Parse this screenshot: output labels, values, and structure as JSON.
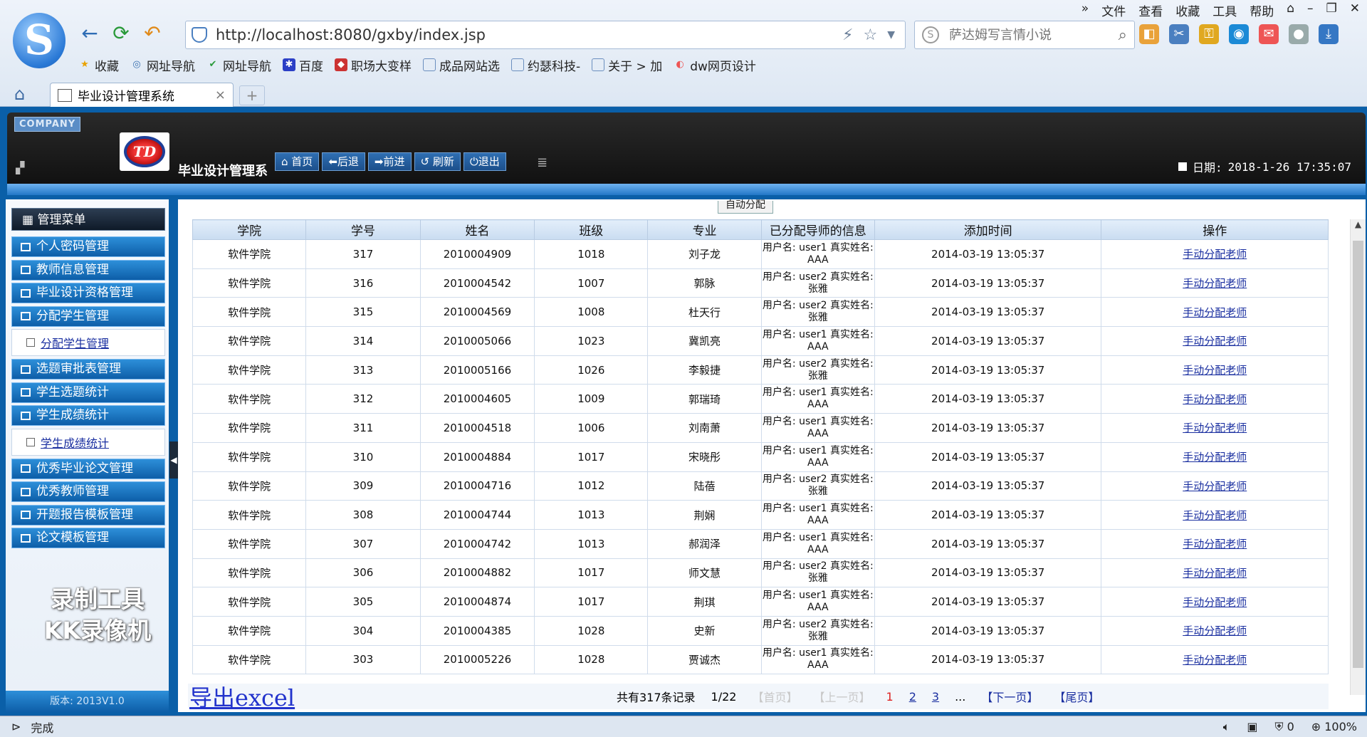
{
  "browser": {
    "menu": [
      "文件",
      "查看",
      "收藏",
      "工具",
      "帮助"
    ],
    "address": "http://localhost:8080/gxby/index.jsp",
    "search_placeholder": "萨达姆写言情小说",
    "favorites": [
      "收藏",
      "网址导航",
      "网址导航",
      "百度",
      "职场大变样",
      "成品网站选",
      "约瑟科技-",
      "关于 > 加",
      "dw网页设计"
    ],
    "tab_title": "毕业设计管理系统",
    "status_text": "完成",
    "status_counter": "0",
    "zoom": "100%"
  },
  "header": {
    "company": "COMPANY",
    "logo_text": "TD",
    "title": "毕业设计管理系",
    "buttons": [
      "首页",
      "后退",
      "前进",
      "刷新",
      "退出"
    ],
    "date_label": "日期:",
    "date_value": "2018-1-26 17:35:07"
  },
  "sidebar": {
    "menu_title": "管理菜单",
    "items": [
      {
        "label": "个人密码管理"
      },
      {
        "label": "教师信息管理"
      },
      {
        "label": "毕业设计资格管理"
      },
      {
        "label": "分配学生管理",
        "sub": "分配学生管理"
      },
      {
        "label": "选题审批表管理"
      },
      {
        "label": "学生选题统计"
      },
      {
        "label": "学生成绩统计",
        "sub": "学生成绩统计"
      },
      {
        "label": "优秀毕业论文管理"
      },
      {
        "label": "优秀教师管理"
      },
      {
        "label": "开题报告模板管理"
      },
      {
        "label": "论文模板管理"
      }
    ],
    "watermark_line1": "录制工具",
    "watermark_line2": "KK录像机",
    "version": "版本: 2013V1.0"
  },
  "content": {
    "tab_label": "自动分配",
    "columns": [
      "学院",
      "学号",
      "姓名",
      "班级",
      "专业",
      "已分配导师的信息",
      "添加时间",
      "操作"
    ],
    "rows": [
      [
        "软件学院",
        "317",
        "2010004909",
        "1018",
        "刘子龙",
        "用户名: user1 真实姓名: AAA",
        "2014-03-19 13:05:37",
        "手动分配老师"
      ],
      [
        "软件学院",
        "316",
        "2010004542",
        "1007",
        "郭脉",
        "用户名: user2 真实姓名: 张雅",
        "2014-03-19 13:05:37",
        "手动分配老师"
      ],
      [
        "软件学院",
        "315",
        "2010004569",
        "1008",
        "杜天行",
        "用户名: user2 真实姓名: 张雅",
        "2014-03-19 13:05:37",
        "手动分配老师"
      ],
      [
        "软件学院",
        "314",
        "2010005066",
        "1023",
        "冀凯亮",
        "用户名: user1 真实姓名: AAA",
        "2014-03-19 13:05:37",
        "手动分配老师"
      ],
      [
        "软件学院",
        "313",
        "2010005166",
        "1026",
        "李毅捷",
        "用户名: user2 真实姓名: 张雅",
        "2014-03-19 13:05:37",
        "手动分配老师"
      ],
      [
        "软件学院",
        "312",
        "2010004605",
        "1009",
        "郭瑞琦",
        "用户名: user1 真实姓名: AAA",
        "2014-03-19 13:05:37",
        "手动分配老师"
      ],
      [
        "软件学院",
        "311",
        "2010004518",
        "1006",
        "刘南萧",
        "用户名: user1 真实姓名: AAA",
        "2014-03-19 13:05:37",
        "手动分配老师"
      ],
      [
        "软件学院",
        "310",
        "2010004884",
        "1017",
        "宋晓彤",
        "用户名: user1 真实姓名: AAA",
        "2014-03-19 13:05:37",
        "手动分配老师"
      ],
      [
        "软件学院",
        "309",
        "2010004716",
        "1012",
        "陆蓓",
        "用户名: user2 真实姓名: 张雅",
        "2014-03-19 13:05:37",
        "手动分配老师"
      ],
      [
        "软件学院",
        "308",
        "2010004744",
        "1013",
        "荆娴",
        "用户名: user1 真实姓名: AAA",
        "2014-03-19 13:05:37",
        "手动分配老师"
      ],
      [
        "软件学院",
        "307",
        "2010004742",
        "1013",
        "郝润泽",
        "用户名: user1 真实姓名: AAA",
        "2014-03-19 13:05:37",
        "手动分配老师"
      ],
      [
        "软件学院",
        "306",
        "2010004882",
        "1017",
        "师文慧",
        "用户名: user2 真实姓名: 张雅",
        "2014-03-19 13:05:37",
        "手动分配老师"
      ],
      [
        "软件学院",
        "305",
        "2010004874",
        "1017",
        "荆琪",
        "用户名: user1 真实姓名: AAA",
        "2014-03-19 13:05:37",
        "手动分配老师"
      ],
      [
        "软件学院",
        "304",
        "2010004385",
        "1028",
        "史新",
        "用户名: user2 真实姓名: 张雅",
        "2014-03-19 13:05:37",
        "手动分配老师"
      ],
      [
        "软件学院",
        "303",
        "2010005226",
        "1028",
        "贾诚杰",
        "用户名: user1 真实姓名: AAA",
        "2014-03-19 13:05:37",
        "手动分配老师"
      ]
    ],
    "export_label": "导出excel",
    "pager": {
      "total": "共有317条记录",
      "page": "1/22",
      "first": "【首页】",
      "prev": "【上一页】",
      "pages": [
        "1",
        "2",
        "3"
      ],
      "ellipsis": "...",
      "next": "【下一页】",
      "last": "【尾页】"
    }
  },
  "colors": {
    "frame_blue": "#0a5fa8",
    "link_blue": "#1a2fa0",
    "current_page_red": "#dd2222"
  }
}
